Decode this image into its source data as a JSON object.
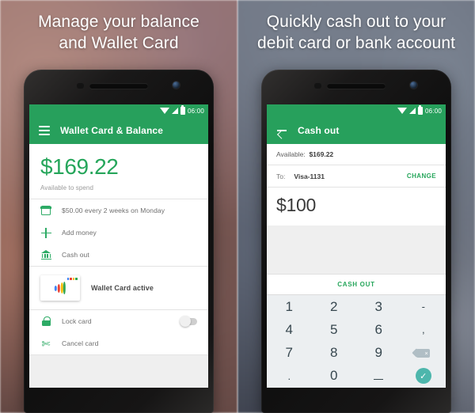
{
  "left": {
    "heading_line1": "Manage your balance",
    "heading_line2": "and Wallet Card",
    "status": {
      "time": "06:00",
      "wifi_icon": "wifi-icon",
      "signal_icon": "signal-icon",
      "battery_icon": "battery-icon"
    },
    "appbar": {
      "menu_icon": "hamburger-menu-icon",
      "title": "Wallet Card & Balance"
    },
    "balance": {
      "amount": "$169.22",
      "subtitle": "Available to spend"
    },
    "rows": [
      {
        "icon": "calendar-icon",
        "label": "$50.00 every 2 weeks on Monday"
      },
      {
        "icon": "plus-icon",
        "label": "Add money"
      },
      {
        "icon": "bank-icon",
        "label": "Cash out"
      }
    ],
    "card": {
      "label": "Wallet Card active",
      "art_name": "google-wallet-card-art"
    },
    "settings": [
      {
        "icon": "lock-icon",
        "label": "Lock card",
        "toggle": "off"
      },
      {
        "icon": "scissors-icon",
        "label": "Cancel card"
      }
    ],
    "nav": {
      "back": "back-triangle-icon",
      "home": "home-circle-icon",
      "recents": "recents-square-icon"
    }
  },
  "right": {
    "heading_line1": "Quickly cash out to your",
    "heading_line2": "debit card or bank account",
    "status": {
      "time": "06:00",
      "wifi_icon": "wifi-icon",
      "signal_icon": "signal-icon",
      "battery_icon": "battery-icon"
    },
    "appbar": {
      "back_icon": "arrow-back-icon",
      "title": "Cash out"
    },
    "available_label": "Available:",
    "available_value": "$169.22",
    "to_label": "To:",
    "to_value": "Visa-1131",
    "change_label": "CHANGE",
    "amount": "$100",
    "cash_out_label": "CASH OUT",
    "keys": [
      {
        "label": "1",
        "name": "key-1",
        "kind": "num"
      },
      {
        "label": "2",
        "name": "key-2",
        "kind": "num"
      },
      {
        "label": "3",
        "name": "key-3",
        "kind": "num"
      },
      {
        "label": "-",
        "name": "key-minus",
        "kind": "sym"
      },
      {
        "label": "4",
        "name": "key-4",
        "kind": "num"
      },
      {
        "label": "5",
        "name": "key-5",
        "kind": "num"
      },
      {
        "label": "6",
        "name": "key-6",
        "kind": "num"
      },
      {
        "label": ",",
        "name": "key-comma",
        "kind": "sym"
      },
      {
        "label": "7",
        "name": "key-7",
        "kind": "num"
      },
      {
        "label": "8",
        "name": "key-8",
        "kind": "num"
      },
      {
        "label": "9",
        "name": "key-9",
        "kind": "num"
      },
      {
        "label": "",
        "name": "key-backspace",
        "kind": "backspace"
      },
      {
        "label": ".",
        "name": "key-period",
        "kind": "sym"
      },
      {
        "label": "0",
        "name": "key-0",
        "kind": "num"
      },
      {
        "label": "_",
        "name": "key-underscore",
        "kind": "underscore"
      },
      {
        "label": "",
        "name": "key-submit",
        "kind": "check"
      }
    ],
    "nav": {
      "back": "keyboard-dismiss-triangle-icon",
      "home": "home-circle-icon",
      "recents": "recents-square-icon"
    }
  },
  "colors": {
    "brand_green": "#27a05c",
    "balance_green": "#26a65b",
    "accent_teal": "#4db6ac",
    "keypad_bg": "#eceff1",
    "card_art": [
      "#4285f4",
      "#ea4335",
      "#fbbc05",
      "#34a853"
    ]
  }
}
